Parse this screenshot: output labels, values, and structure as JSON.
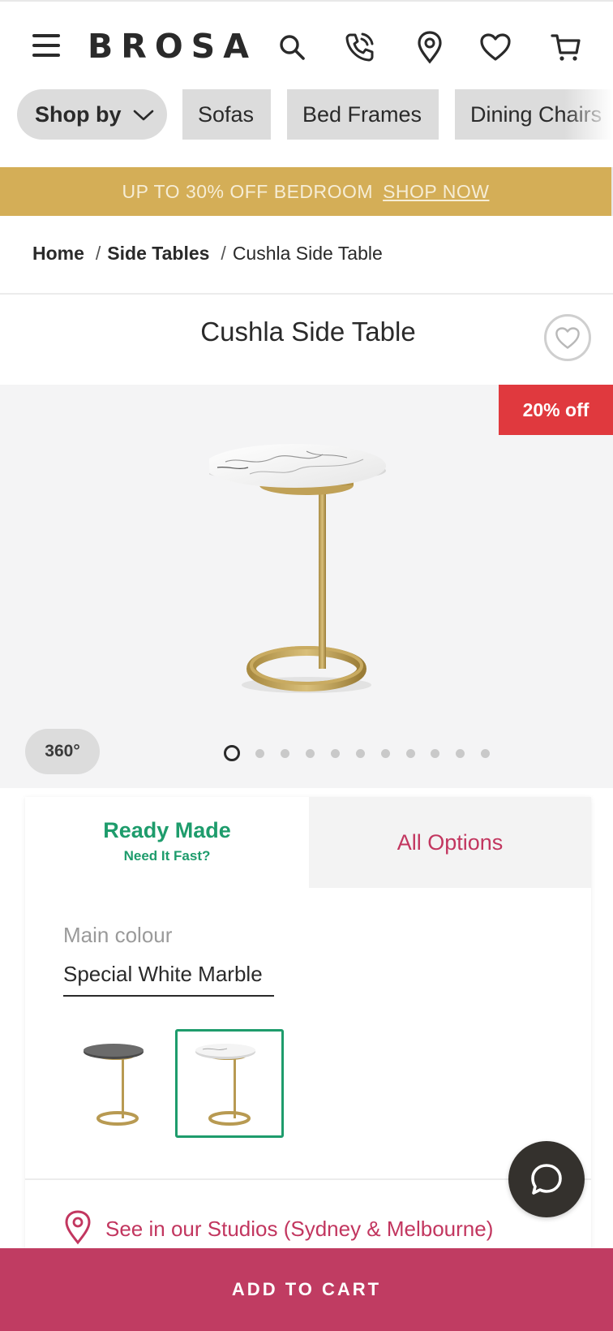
{
  "header": {
    "logo": "BROSA",
    "icons": [
      "menu-icon",
      "search-icon",
      "phone-icon",
      "location-icon",
      "heart-icon",
      "cart-icon"
    ]
  },
  "categories": [
    {
      "label": "Shop by"
    },
    {
      "label": "Sofas"
    },
    {
      "label": "Bed Frames"
    },
    {
      "label": "Dining Chairs"
    }
  ],
  "promo": {
    "text": "UP TO 30% OFF BEDROOM",
    "link": "SHOP NOW",
    "color": "#d4ae57"
  },
  "breadcrumb": {
    "home": "Home",
    "category": "Side Tables",
    "current": "Cushla Side Table",
    "separator": "/"
  },
  "product": {
    "title": "Cushla Side Table",
    "discount_badge": "20% off",
    "view360_label": "360°",
    "image_count": 11,
    "active_image": 1
  },
  "options": {
    "tab_ready": "Ready Made",
    "tab_ready_sub": "Need It Fast?",
    "tab_all": "All Options",
    "colour_label": "Main colour",
    "colour_value": "Special White Marble",
    "swatches": [
      "Black Glass",
      "Special White Marble"
    ],
    "selected_swatch": 1,
    "studio_text": "See in our Studios (Sydney & Melbourne)"
  },
  "cta": {
    "add_to_cart": "ADD TO CART",
    "color": "#c03c62"
  },
  "colors": {
    "accent_green": "#1e9c6c",
    "accent_pink": "#c2365f",
    "badge_red": "#e0393e"
  }
}
